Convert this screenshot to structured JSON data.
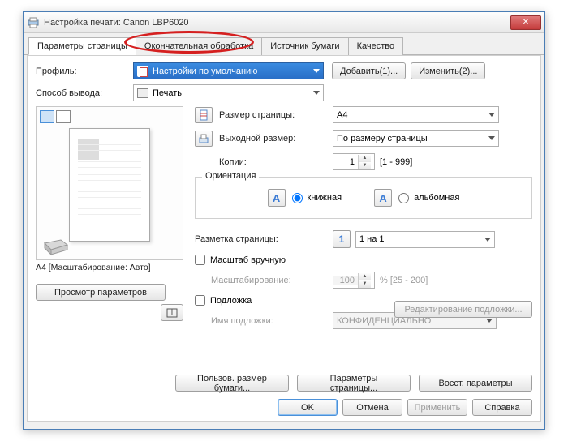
{
  "window": {
    "title": "Настройка печати: Canon LBP6020"
  },
  "tabs": [
    "Параметры страницы",
    "Окончательная обработка",
    "Источник бумаги",
    "Качество"
  ],
  "active_tab": 0,
  "profile": {
    "label": "Профиль:",
    "value": "Настройки по умолчанию",
    "add": "Добавить(1)...",
    "edit": "Изменить(2)..."
  },
  "output": {
    "label": "Способ вывода:",
    "value": "Печать"
  },
  "preview": {
    "caption": "A4 [Масштабирование: Авто]",
    "view_params": "Просмотр параметров"
  },
  "page_size": {
    "label": "Размер страницы:",
    "value": "A4"
  },
  "out_size": {
    "label": "Выходной размер:",
    "value": "По размеру страницы"
  },
  "copies": {
    "label": "Копии:",
    "value": "1",
    "range": "[1 - 999]"
  },
  "orientation": {
    "legend": "Ориентация",
    "portrait": "книжная",
    "landscape": "альбомная",
    "selected": "portrait"
  },
  "layout": {
    "label": "Разметка страницы:",
    "value": "1 на 1",
    "num": "1"
  },
  "manual_scale": {
    "label": "Масштаб вручную",
    "checked": false
  },
  "scaling": {
    "label": "Масштабирование:",
    "value": "100",
    "range": "% [25 - 200]"
  },
  "watermark": {
    "label": "Подложка",
    "checked": false,
    "name_label": "Имя подложки:",
    "value": "КОНФИДЕНЦИАЛЬНО",
    "edit": "Редактирование подложки..."
  },
  "bottom": {
    "custom_size": "Пользов. размер бумаги...",
    "page_params": "Параметры страницы...",
    "restore": "Восст. параметры"
  },
  "dialog": {
    "ok": "OK",
    "cancel": "Отмена",
    "apply": "Применить",
    "help": "Справка"
  }
}
